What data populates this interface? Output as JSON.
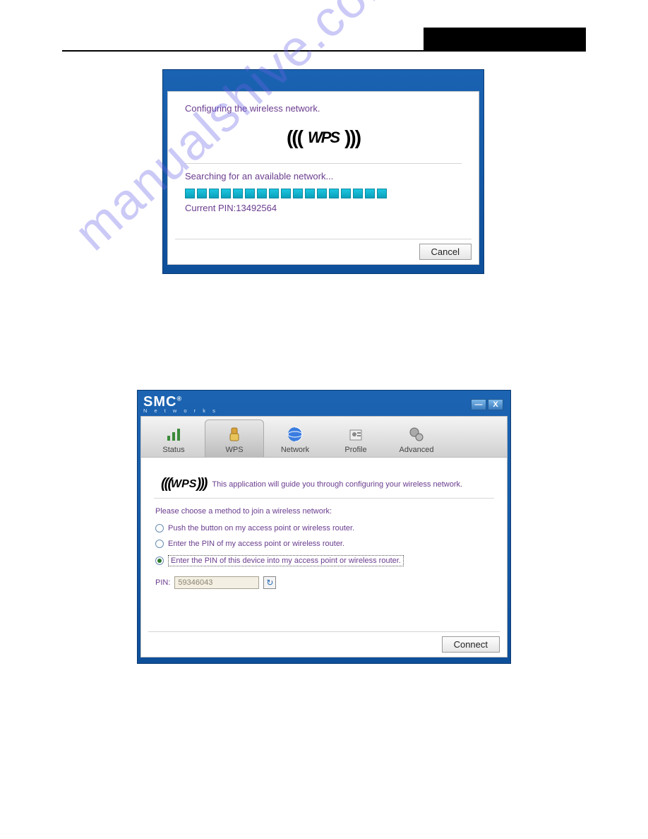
{
  "page": {
    "header_text": "",
    "page_number": ""
  },
  "watermark": "manualshive.com",
  "dialog1": {
    "title": "Configuring the wireless network.",
    "wps_label": "WPS",
    "status": "Searching for an available network...",
    "progress_segments": 17,
    "pin_prefix": "Current PIN:",
    "pin_value": "13492564",
    "cancel": "Cancel"
  },
  "dialog2": {
    "brand": {
      "name": "SMC",
      "sub": "N e t w o r k s"
    },
    "winbtns": {
      "min": "—",
      "close": "X"
    },
    "tabs": [
      {
        "id": "status",
        "label": "Status"
      },
      {
        "id": "wps",
        "label": "WPS"
      },
      {
        "id": "network",
        "label": "Network"
      },
      {
        "id": "profile",
        "label": "Profile"
      },
      {
        "id": "advanced",
        "label": "Advanced"
      }
    ],
    "active_tab": "wps",
    "wps_label": "WPS",
    "guide_text": "This application will guide you through configuring your wireless network.",
    "choose_text": "Please choose a method to join a wireless network:",
    "options": [
      "Push the button on my access point or wireless router.",
      "Enter the PIN of my access point or wireless router.",
      "Enter the PIN of this device into my access point or wireless router."
    ],
    "selected_option": 2,
    "pin_label": "PIN:",
    "pin_value": "59346043",
    "connect": "Connect"
  }
}
